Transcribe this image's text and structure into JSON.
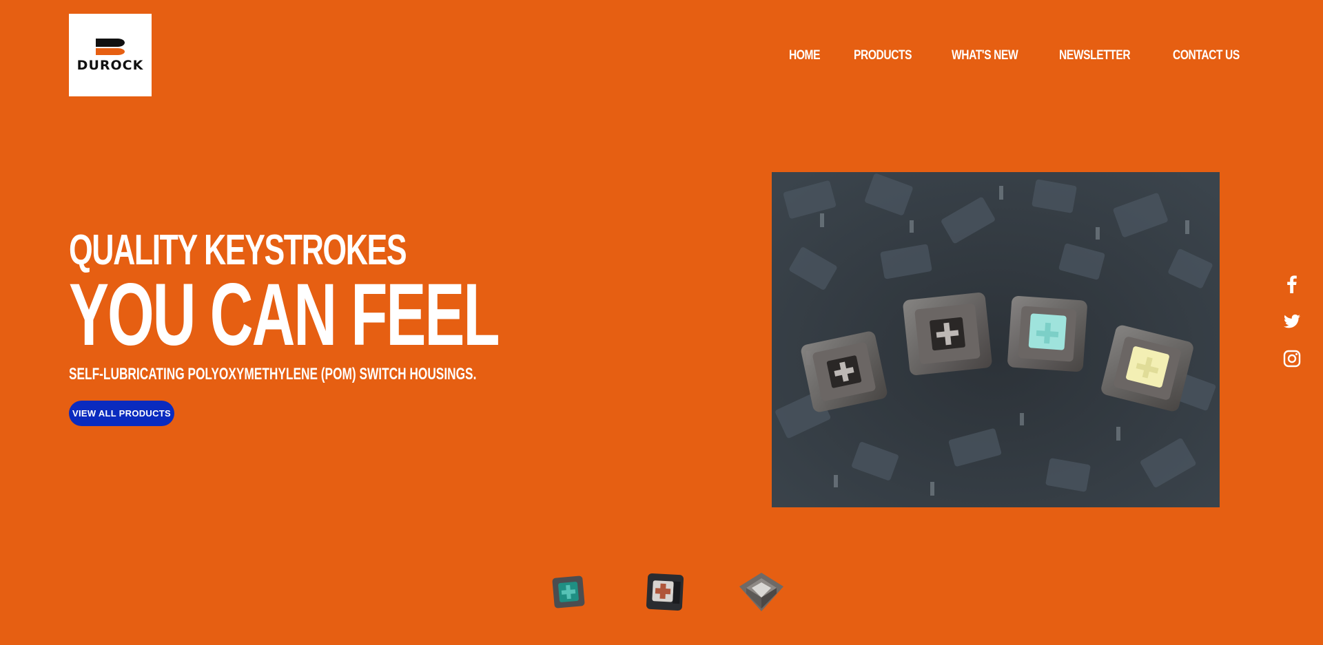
{
  "brand": {
    "name": "DUROCK"
  },
  "nav": {
    "items": [
      {
        "label": "HOME"
      },
      {
        "label": "PRODUCTS"
      },
      {
        "label": "WHAT'S NEW"
      },
      {
        "label": "NEWSLETTER"
      },
      {
        "label": "CONTACT US"
      }
    ]
  },
  "hero": {
    "subtitle": "QUALITY KEYSTROKES",
    "title": "YOU CAN FEEL",
    "description": "SELF-LUBRICATING POLYOXYMETHYLENE (POM) SWITCH HOUSINGS.",
    "cta_label": "VIEW ALL PRODUCTS",
    "image_icon": "keyboard-switches-photo"
  },
  "social": {
    "icons": [
      "facebook-icon",
      "twitter-icon",
      "instagram-icon"
    ]
  },
  "thumbnails": {
    "items": [
      "switch-teal-thumbnail",
      "switch-dark-thumbnail",
      "switch-smoke-thumbnail"
    ]
  },
  "colors": {
    "background": "#e65f12",
    "cta": "#0a2bbf",
    "text": "#ffffff"
  }
}
